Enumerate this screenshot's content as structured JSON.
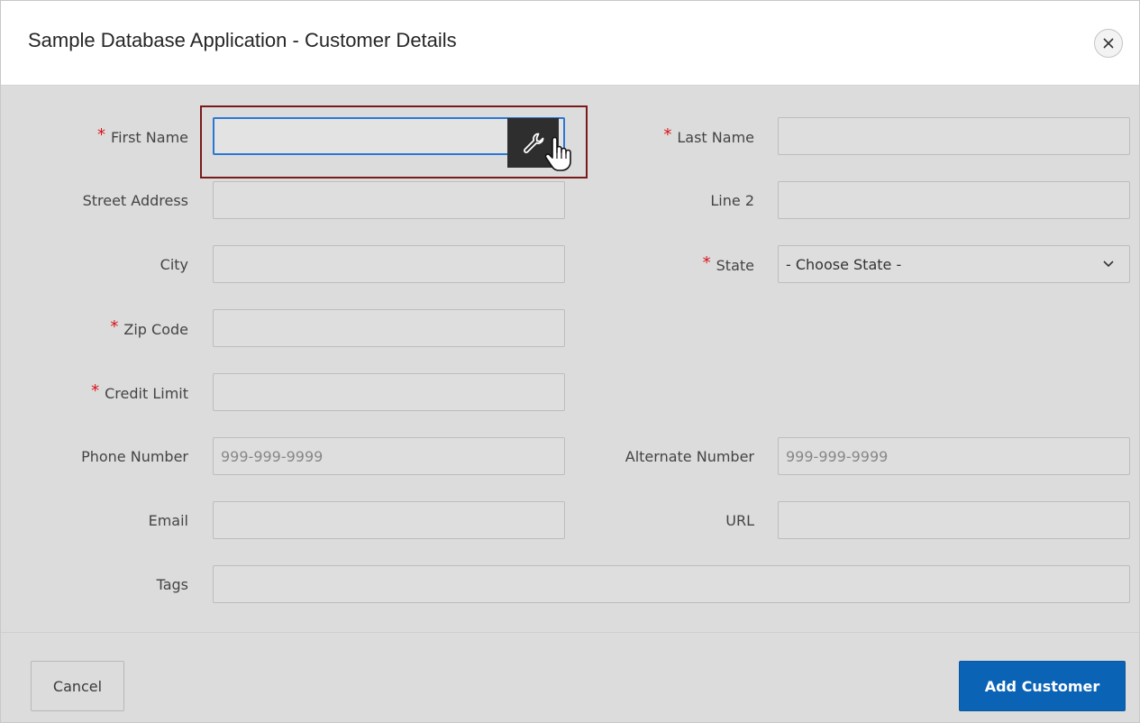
{
  "dialog": {
    "title": "Sample Database Application - Customer Details",
    "close_icon": "close-icon"
  },
  "form": {
    "required_marker": "*",
    "first_name": {
      "label": "First Name",
      "value": "",
      "required": true
    },
    "last_name": {
      "label": "Last Name",
      "value": "",
      "required": true
    },
    "street_address": {
      "label": "Street Address",
      "value": ""
    },
    "line2": {
      "label": "Line 2",
      "value": ""
    },
    "city": {
      "label": "City",
      "value": ""
    },
    "state": {
      "label": "State",
      "selected": "- Choose State -",
      "required": true
    },
    "zip_code": {
      "label": "Zip Code",
      "value": "",
      "required": true
    },
    "credit_limit": {
      "label": "Credit Limit",
      "value": "",
      "required": true
    },
    "phone_number": {
      "label": "Phone Number",
      "placeholder": "999-999-9999"
    },
    "alternate_number": {
      "label": "Alternate Number",
      "placeholder": "999-999-9999"
    },
    "email": {
      "label": "Email",
      "value": ""
    },
    "url": {
      "label": "URL",
      "value": ""
    },
    "tags": {
      "label": "Tags",
      "value": ""
    }
  },
  "quick_edit": {
    "icon": "wrench-icon",
    "cursor": "hand-pointer-icon"
  },
  "footer": {
    "cancel_label": "Cancel",
    "add_label": "Add Customer"
  },
  "colors": {
    "accent": "#0b63b6",
    "required": "#d9131b",
    "focus_border": "#2b78d4",
    "highlight_border": "#7a1b1b"
  }
}
